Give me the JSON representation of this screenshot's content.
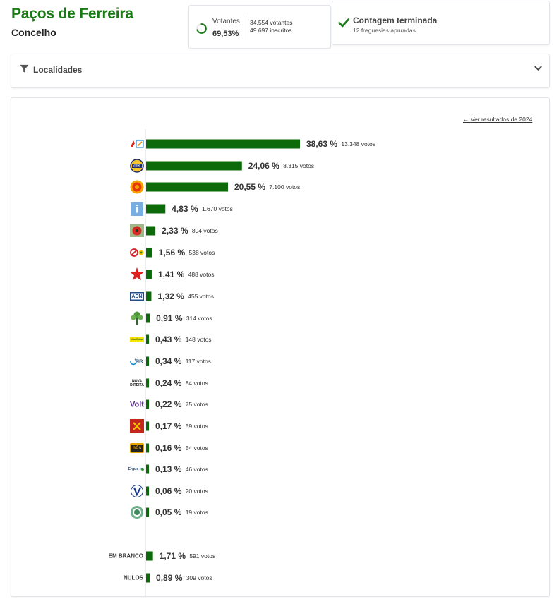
{
  "header": {
    "title": "Paços de Ferreira",
    "subtitle": "Concelho"
  },
  "turnout": {
    "label": "Votantes",
    "percent": "69,53%",
    "progress": 0.6953,
    "voters": "34.554 votantes",
    "registered": "49.697 inscritos"
  },
  "count_status": {
    "title": "Contagem terminada",
    "subtitle": "12 freguesias apuradas"
  },
  "filter": {
    "label": "Localidades"
  },
  "results": {
    "previous_link": "Ver resultados de 2024"
  },
  "colors": {
    "brand_green": "#1a7a17",
    "bar_green": "#0c6a0b",
    "axis_line": "#d9dde2"
  },
  "chart_data": {
    "type": "bar",
    "orientation": "horizontal",
    "xlim": [
      0,
      38.63
    ],
    "categories": [
      "",
      "",
      "",
      "",
      "",
      "",
      "",
      "",
      "",
      "",
      "",
      "",
      "",
      "",
      "",
      "",
      "",
      "",
      "EM BRANCO",
      "NULOS"
    ],
    "logos": [
      "ps-psd-logo",
      "coalition-logo",
      "sun-logo",
      "info-logo",
      "flower-logo",
      "pcp-pev-logo",
      "red-star-logo",
      "adn-logo",
      "tree-logo",
      "green-logo",
      "rir-logo",
      "nova-direita-logo",
      "volt-logo",
      "hammer-sickle-logo",
      "nos-logo",
      "ergue-te-logo",
      "blue-circle-logo",
      "green-circle-logo",
      "",
      ""
    ],
    "values": [
      38.63,
      24.06,
      20.55,
      4.83,
      2.33,
      1.56,
      1.41,
      1.32,
      0.91,
      0.43,
      0.34,
      0.24,
      0.22,
      0.17,
      0.16,
      0.13,
      0.06,
      0.05,
      1.71,
      0.89
    ],
    "value_labels": [
      "38,63 %",
      "24,06 %",
      "20,55 %",
      "4,83 %",
      "2,33 %",
      "1,56 %",
      "1,41 %",
      "1,32 %",
      "0,91 %",
      "0,43 %",
      "0,34 %",
      "0,24 %",
      "0,22 %",
      "0,17 %",
      "0,16 %",
      "0,13 %",
      "0,06 %",
      "0,05 %",
      "1,71 %",
      "0,89 %"
    ],
    "vote_labels": [
      "13.348 votos",
      "8.315 votos",
      "7.100 votos",
      "1.670 votos",
      "804 votos",
      "538 votos",
      "488 votos",
      "455 votos",
      "314 votos",
      "148 votos",
      "117 votos",
      "84 votos",
      "75 votos",
      "59 votos",
      "54 votos",
      "46 votos",
      "20 votos",
      "19 votos",
      "591 votos",
      "309 votos"
    ],
    "grid": false,
    "legend": "none"
  }
}
